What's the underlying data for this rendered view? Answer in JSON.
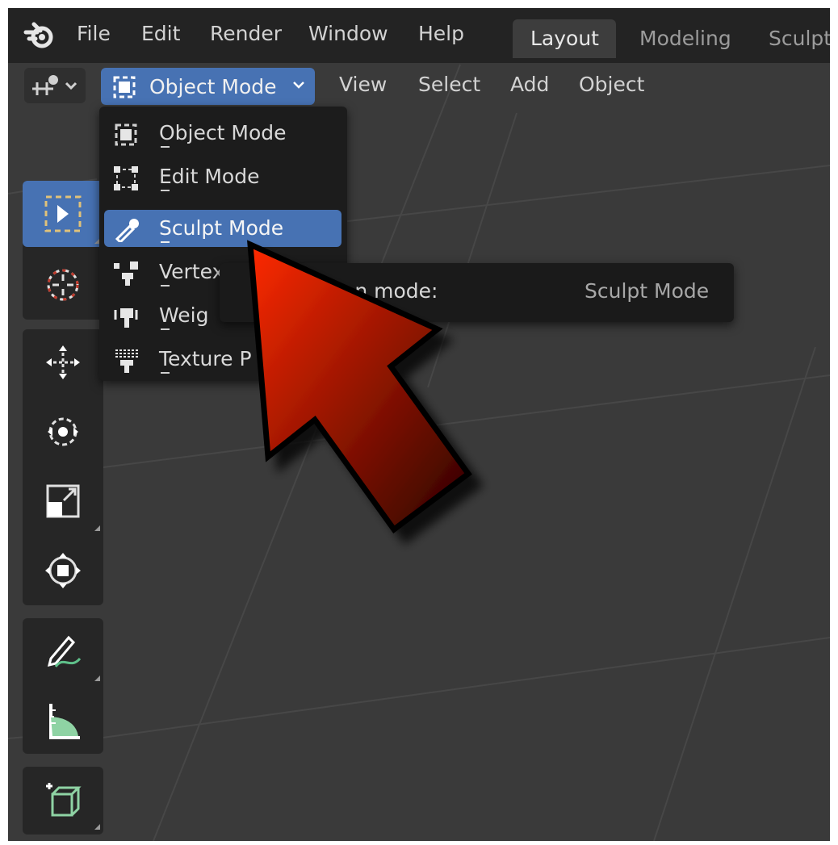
{
  "topbar": {
    "menu": [
      "File",
      "Edit",
      "Render",
      "Window",
      "Help"
    ],
    "workspaces": [
      {
        "label": "Layout",
        "active": true
      },
      {
        "label": "Modeling",
        "active": false
      },
      {
        "label": "Sculpti",
        "active": false
      }
    ]
  },
  "header": {
    "mode_label": "Object Mode",
    "menu": [
      "View",
      "Select",
      "Add",
      "Object"
    ]
  },
  "toolbar": {
    "tools": [
      {
        "icon": "select-box-icon",
        "active": true
      },
      {
        "icon": "cursor-icon",
        "active": false
      },
      {
        "icon": "move-icon",
        "active": false
      },
      {
        "icon": "rotate-icon",
        "active": false
      },
      {
        "icon": "scale-icon",
        "active": false
      },
      {
        "icon": "transform-icon",
        "active": false
      },
      {
        "icon": "annotate-icon",
        "active": false
      },
      {
        "icon": "measure-icon",
        "active": false
      },
      {
        "icon": "add-cube-icon",
        "active": false
      }
    ]
  },
  "mode_menu": {
    "items": [
      {
        "label": "Object Mode",
        "icon": "object-mode-icon",
        "highlighted": false
      },
      {
        "label": "Edit Mode",
        "icon": "edit-mode-icon",
        "highlighted": false
      },
      {
        "label": "Sculpt Mode",
        "icon": "sculpt-mode-icon",
        "highlighted": true
      },
      {
        "label": "Vertex P",
        "icon": "vertex-paint-icon",
        "highlighted": false
      },
      {
        "label": "Weig",
        "icon": "weight-paint-icon",
        "highlighted": false
      },
      {
        "label": "Texture P",
        "icon": "texture-paint-icon",
        "highlighted": false
      }
    ]
  },
  "tooltip": {
    "text": "interaction mode:",
    "value": "Sculpt Mode"
  },
  "colors": {
    "accent": "#4772b3",
    "arrow_fill_start": "#ff2a00",
    "arrow_fill_end": "#2a0000"
  }
}
